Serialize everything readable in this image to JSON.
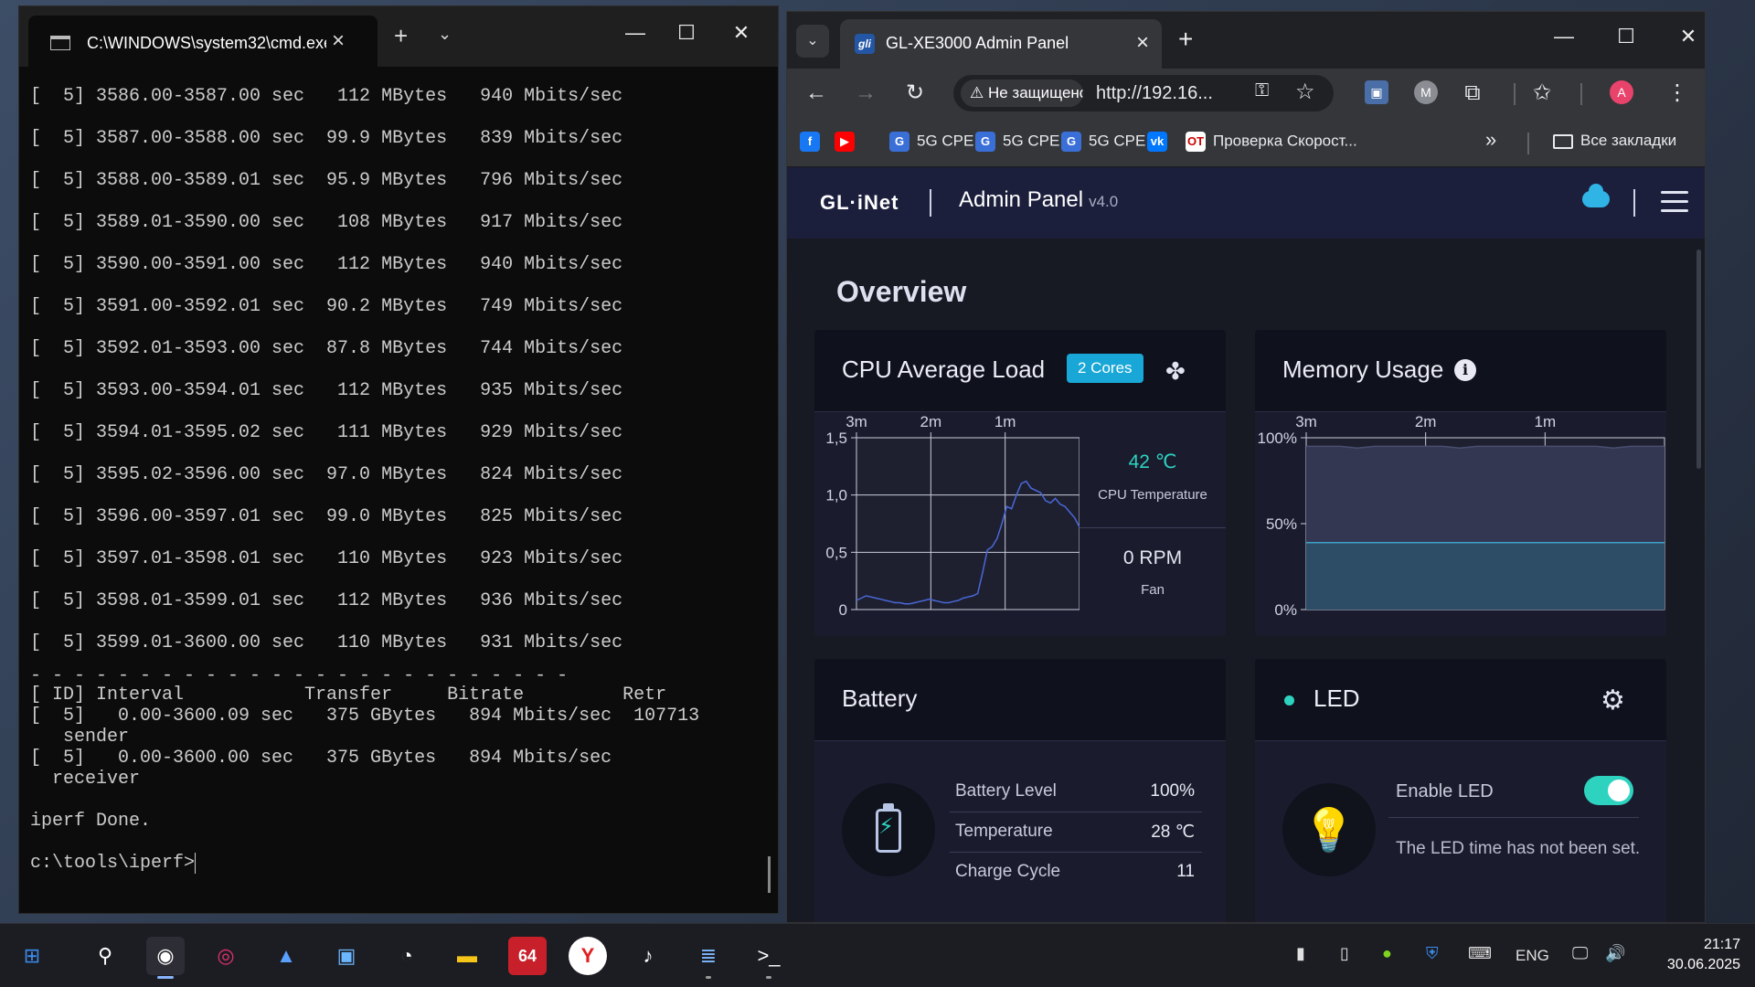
{
  "cmd": {
    "tab_title": "C:\\WINDOWS\\system32\\cmd.exe",
    "lines": [
      "[  5] 3586.00-3587.00 sec   112 MBytes   940 Mbits/sec",
      "[  5] 3587.00-3588.00 sec  99.9 MBytes   839 Mbits/sec",
      "[  5] 3588.00-3589.01 sec  95.9 MBytes   796 Mbits/sec",
      "[  5] 3589.01-3590.00 sec   108 MBytes   917 Mbits/sec",
      "[  5] 3590.00-3591.00 sec   112 MBytes   940 Mbits/sec",
      "[  5] 3591.00-3592.01 sec  90.2 MBytes   749 Mbits/sec",
      "[  5] 3592.01-3593.00 sec  87.8 MBytes   744 Mbits/sec",
      "[  5] 3593.00-3594.01 sec   112 MBytes   935 Mbits/sec",
      "[  5] 3594.01-3595.02 sec   111 MBytes   929 Mbits/sec",
      "[  5] 3595.02-3596.00 sec  97.0 MBytes   824 Mbits/sec",
      "[  5] 3596.00-3597.01 sec  99.0 MBytes   825 Mbits/sec",
      "[  5] 3597.01-3598.01 sec   110 MBytes   923 Mbits/sec",
      "[  5] 3598.01-3599.01 sec   112 MBytes   936 Mbits/sec",
      "[  5] 3599.01-3600.00 sec   110 MBytes   931 Mbits/sec"
    ],
    "separator": "- - - - - - - - - - - - - - - - - - - - - - - - -",
    "summary_header": "[ ID] Interval           Transfer     Bitrate         Retr",
    "summary_sender": "[  5]   0.00-3600.09 sec   375 GBytes   894 Mbits/sec  107713",
    "summary_sender_label": "   sender",
    "summary_receiver": "[  5]   0.00-3600.00 sec   375 GBytes   894 Mbits/sec",
    "summary_receiver_label": "  receiver",
    "done": "iperf Done.",
    "prompt": "c:\\tools\\iperf>"
  },
  "browser": {
    "tab_title": "GL-XE3000 Admin Panel",
    "favicon_text": "gli",
    "security_warning": "Не защищено",
    "url": "http://192.16...",
    "profile_initial": "A",
    "ext_initial": "M",
    "bookmarks": [
      {
        "label": "",
        "icon": "facebook-icon",
        "color": "#1877f2",
        "glyph": "f"
      },
      {
        "label": "",
        "icon": "youtube-icon",
        "color": "#ff0000",
        "glyph": "▶"
      },
      {
        "label": "5G CPE",
        "icon": "gl-favicon-icon",
        "color": "#3b6fd8",
        "glyph": "G"
      },
      {
        "label": "5G CPE",
        "icon": "gl-favicon-icon",
        "color": "#3b6fd8",
        "glyph": "G"
      },
      {
        "label": "5G CPE",
        "icon": "gl-favicon-icon",
        "color": "#3b6fd8",
        "glyph": "G"
      },
      {
        "label": "",
        "icon": "vk-icon",
        "color": "#0077ff",
        "glyph": "vk"
      },
      {
        "label": "Проверка Скорост...",
        "icon": "speedtest-icon",
        "color": "#ffffff",
        "glyph": "OT"
      }
    ],
    "all_bookmarks": "Все закладки"
  },
  "panel": {
    "logo": "GL·iNet",
    "title": "Admin Panel",
    "version": "v4.0",
    "overview": "Overview",
    "cpu": {
      "title": "CPU Average Load",
      "badge": "2 Cores",
      "temp": "42 ℃",
      "temp_label": "CPU Temperature",
      "fan": "0 RPM",
      "fan_label": "Fan"
    },
    "memory": {
      "title": "Memory Usage"
    },
    "battery": {
      "title": "Battery",
      "rows": [
        {
          "label": "Battery Level",
          "value": "100%"
        },
        {
          "label": "Temperature",
          "value": "28 ℃"
        },
        {
          "label": "Charge Cycle",
          "value": "11"
        }
      ]
    },
    "led": {
      "title": "LED",
      "enable_label": "Enable LED",
      "enabled": true,
      "note": "The LED time has not been set."
    },
    "colors": {
      "accent": "#2ed3c0",
      "badge": "#18a7d6",
      "header": "#1c1f3c"
    }
  },
  "chart_data": [
    {
      "type": "line",
      "x_ticks": [
        "3m",
        "2m",
        "1m"
      ],
      "y_ticks": [
        "1,5",
        "1,0",
        "0,5",
        "0"
      ],
      "ylim": [
        0,
        1.5
      ],
      "grid": true,
      "series": [
        {
          "values": [
            0.08,
            0.1,
            0.12,
            0.11,
            0.1,
            0.09,
            0.08,
            0.07,
            0.06,
            0.06,
            0.05,
            0.05,
            0.06,
            0.07,
            0.08,
            0.09,
            0.08,
            0.07,
            0.06,
            0.06,
            0.07,
            0.08,
            0.1,
            0.11,
            0.12,
            0.14,
            0.32,
            0.52,
            0.55,
            0.62,
            0.75,
            0.9,
            0.88,
            1.0,
            1.1,
            1.12,
            1.06,
            1.04,
            1.02,
            0.95,
            0.93,
            0.97,
            0.92,
            0.9,
            0.85,
            0.8,
            0.72
          ]
        }
      ]
    },
    {
      "type": "area",
      "x_ticks": [
        "3m",
        "2m",
        "1m"
      ],
      "y_ticks": [
        "100%",
        "50%",
        "0%"
      ],
      "ylim": [
        0,
        100
      ],
      "grid": true,
      "series": [
        {
          "values": [
            95,
            95,
            95,
            94,
            95,
            95,
            95,
            95,
            95,
            94,
            95,
            95,
            95,
            95,
            95,
            95,
            95,
            95,
            94,
            95,
            95,
            95
          ]
        },
        {
          "values": [
            39,
            39,
            39,
            39,
            39,
            39,
            39,
            39,
            39,
            39,
            39,
            39,
            39,
            39,
            39,
            39,
            39,
            39,
            39,
            39,
            39,
            39
          ]
        }
      ]
    }
  ],
  "taskbar": {
    "language": "ENG",
    "time": "21:17",
    "date": "30.06.2025",
    "apps": [
      {
        "name": "start-icon",
        "glyph": "⊞"
      },
      {
        "name": "search-icon",
        "glyph": "⚲"
      },
      {
        "name": "chrome-icon",
        "glyph": "◉"
      },
      {
        "name": "instagram-icon",
        "glyph": "◎"
      },
      {
        "name": "photos-icon",
        "glyph": "▲"
      },
      {
        "name": "image-viewer-icon",
        "glyph": "▣"
      },
      {
        "name": "speedometer-icon",
        "glyph": "◔"
      },
      {
        "name": "file-explorer-icon",
        "glyph": "▬"
      },
      {
        "name": "aida64-icon",
        "glyph": "64"
      },
      {
        "name": "yandex-browser-icon",
        "glyph": "Y"
      },
      {
        "name": "tiktok-icon",
        "glyph": "♪"
      },
      {
        "name": "notepad-icon",
        "glyph": "≣"
      },
      {
        "name": "terminal-icon",
        "glyph": ">_"
      }
    ]
  }
}
